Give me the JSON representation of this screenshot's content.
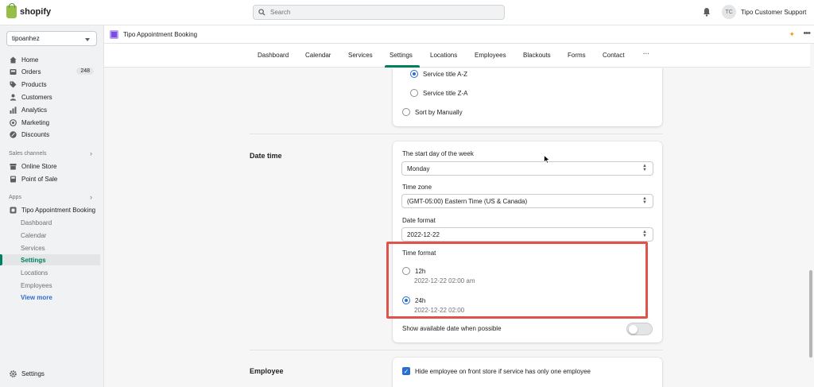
{
  "topbar": {
    "brand": "shopify",
    "search_placeholder": "Search",
    "user_initials": "TC",
    "user_name": "Tipo Customer Support"
  },
  "sidebar": {
    "store": "tipoanhez",
    "nav": [
      {
        "label": "Home",
        "icon": "home-icon"
      },
      {
        "label": "Orders",
        "icon": "orders-icon",
        "badge": "248"
      },
      {
        "label": "Products",
        "icon": "tag-icon"
      },
      {
        "label": "Customers",
        "icon": "person-icon"
      },
      {
        "label": "Analytics",
        "icon": "bar-chart-icon"
      },
      {
        "label": "Marketing",
        "icon": "target-icon"
      },
      {
        "label": "Discounts",
        "icon": "discount-icon"
      }
    ],
    "sales_channels_label": "Sales channels",
    "channels": [
      {
        "label": "Online Store",
        "icon": "store-icon"
      },
      {
        "label": "Point of Sale",
        "icon": "pos-icon"
      }
    ],
    "apps_label": "Apps",
    "app_name": "Tipo Appointment Booking",
    "app_items": [
      "Dashboard",
      "Calendar",
      "Services",
      "Settings",
      "Locations",
      "Employees"
    ],
    "view_more": "View more",
    "settings": "Settings"
  },
  "app_header": {
    "title": "Tipo Appointment Booking"
  },
  "tabs": [
    "Dashboard",
    "Calendar",
    "Services",
    "Settings",
    "Locations",
    "Employees",
    "Blackouts",
    "Forms",
    "Contact"
  ],
  "tabs_more": "···",
  "sort_card": {
    "options": [
      "Service title A-Z",
      "Service title Z-A"
    ],
    "manual": "Sort by Manually"
  },
  "date_time": {
    "section_title": "Date time",
    "start_day_label": "The start day of the week",
    "start_day_value": "Monday",
    "timezone_label": "Time zone",
    "timezone_value": "(GMT-05:00) Eastern Time (US & Canada)",
    "date_format_label": "Date format",
    "date_format_value": "2022-12-22",
    "time_format_label": "Time format",
    "time_12h": "12h",
    "time_12h_example": "2022-12-22 02:00 am",
    "time_24h": "24h",
    "time_24h_example": "2022-12-22 02:00",
    "show_available_label": "Show available date when possible"
  },
  "employee": {
    "section_title": "Employee",
    "hide_label": "Hide employee on front store if service has only one employee"
  },
  "colors": {
    "accent": "#008060",
    "highlight": "#e0534a",
    "radio_selected": "#2c6ecb"
  }
}
